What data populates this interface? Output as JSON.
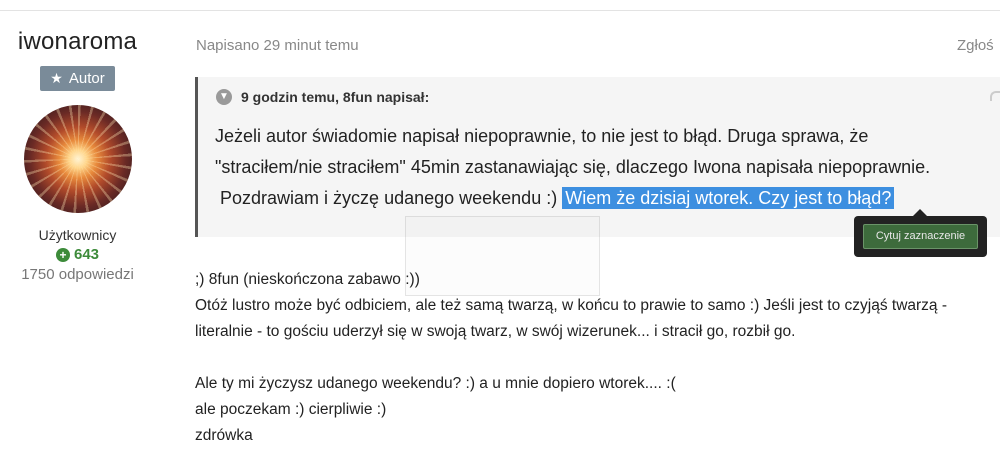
{
  "author": {
    "name": "iwonaroma",
    "badge": "Autor",
    "role": "Użytkownicy",
    "reputation": "643",
    "posts": "1750 odpowiedzi"
  },
  "post": {
    "date": "Napisano 29 minut temu",
    "report": "Zgłoś"
  },
  "quote": {
    "header": "9 godzin temu, 8fun napisał:",
    "line1": "Jeżeli autor świadomie napisał niepoprawnie, to nie jest to błąd. Druga sprawa, że",
    "line2": "\"straciłem/nie straciłem\" 45min zastanawiając się, dlaczego Iwona napisała niepoprawnie.",
    "line3": "Pozdrawiam i życzę udanego weekendu :)",
    "selected": "Wiem że dzisiaj wtorek. Czy jest to błąd?"
  },
  "tooltip": {
    "label": "Cytuj zaznaczenie"
  },
  "body": {
    "lines": [
      ";) 8fun (nieskończona zabawo :))",
      "Otóż lustro może być odbiciem, ale też samą twarzą, w końcu to prawie to samo :) Jeśli jest to czyjąś twarzą -",
      "literalnie - to gościu uderzył się w swoją  twarz, w swój wizerunek... i stracił go, rozbił go.",
      "",
      "Ale ty mi życzysz udanego weekendu? :) a u mnie dopiero wtorek.... :(",
      "ale poczekam :) cierpliwie :)",
      "zdrówka"
    ]
  }
}
